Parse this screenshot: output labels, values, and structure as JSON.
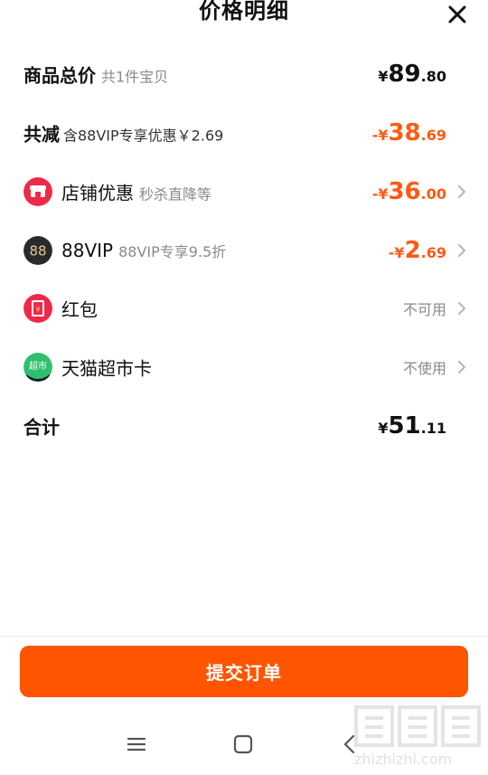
{
  "header": {
    "title": "价格明细"
  },
  "rows": {
    "goods_total": {
      "label": "商品总价",
      "sub": "共1件宝贝",
      "amount": {
        "prefix": "",
        "yen": "¥",
        "int": "89",
        "dec": ".80"
      }
    },
    "total_reduction": {
      "label": "共减",
      "sub": "含88VIP专享优惠￥2.69",
      "amount": {
        "prefix": "-",
        "yen": "¥",
        "int": "38",
        "dec": ".69"
      }
    },
    "store_discount": {
      "label": "店铺优惠",
      "sub": "秒杀直降等",
      "icon": "store-icon",
      "amount": {
        "prefix": "-",
        "yen": "¥",
        "int": "36",
        "dec": ".00"
      }
    },
    "vip": {
      "label": "88VIP",
      "sub": "88VIP专享9.5折",
      "icon": "88vip-icon",
      "amount": {
        "prefix": "-",
        "yen": "¥",
        "int": "2",
        "dec": ".69"
      }
    },
    "red_packet": {
      "label": "红包",
      "icon": "red-packet-icon",
      "status": "不可用"
    },
    "tmall_card": {
      "label": "天猫超市卡",
      "icon": "tmall-supermarket-card-icon",
      "status": "不使用"
    },
    "sum": {
      "label": "合计",
      "amount": {
        "prefix": "",
        "yen": "¥",
        "int": "51",
        "dec": ".11"
      }
    }
  },
  "icon_labels": {
    "vip_badge": "88",
    "supermarket_badge": "超市"
  },
  "footer": {
    "submit_label": "提交订单"
  },
  "watermark": {
    "text": "zhizhizhi.com"
  },
  "colors": {
    "accent": "#ff5500",
    "discount": "#ff5a12",
    "muted": "#8a8a8a"
  }
}
